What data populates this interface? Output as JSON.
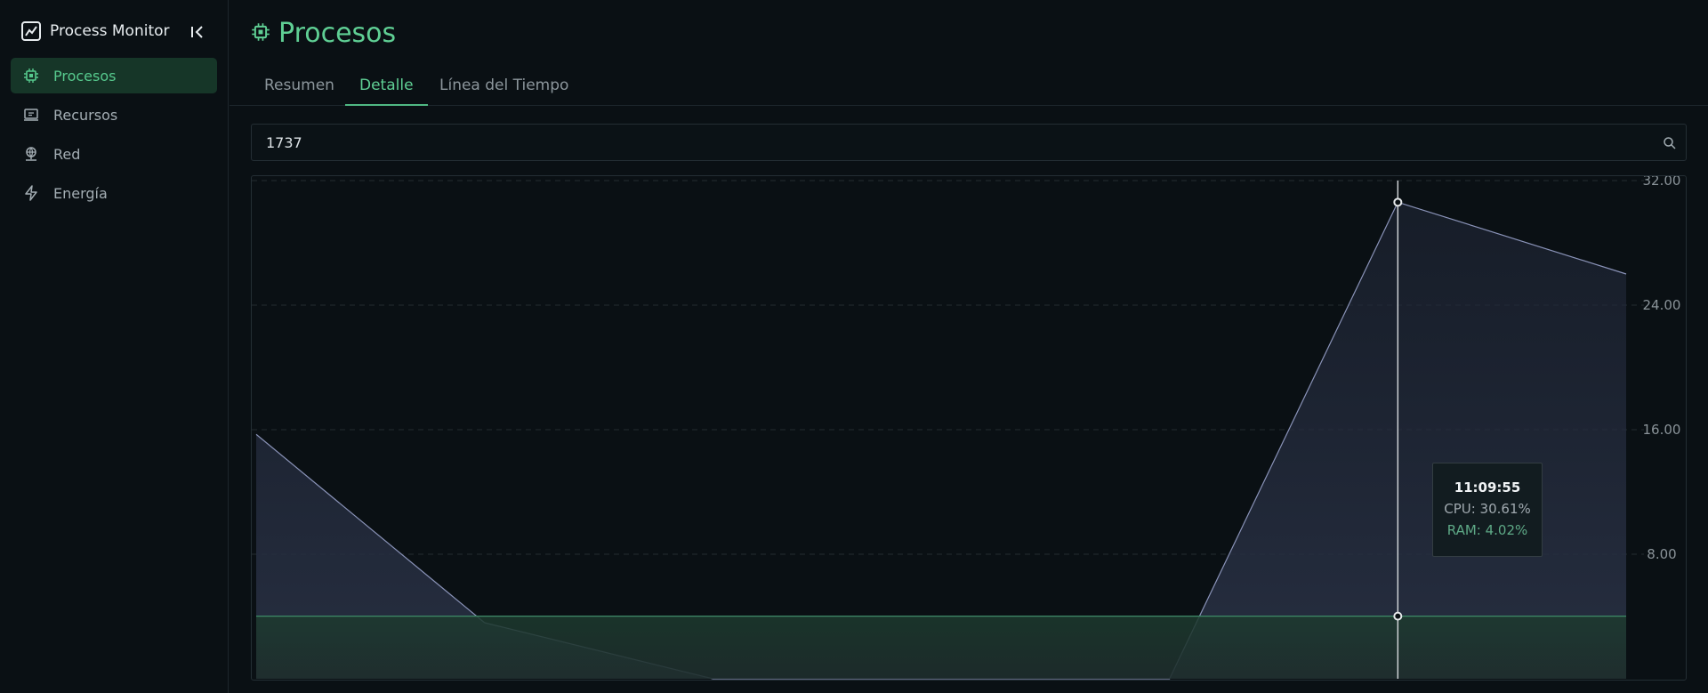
{
  "app": {
    "title": "Process Monitor"
  },
  "sidebar": {
    "items": [
      {
        "label": "Procesos",
        "icon": "cpu-icon",
        "active": true
      },
      {
        "label": "Recursos",
        "icon": "monitor-icon",
        "active": false
      },
      {
        "label": "Red",
        "icon": "network-icon",
        "active": false
      },
      {
        "label": "Energía",
        "icon": "bolt-icon",
        "active": false
      }
    ]
  },
  "header": {
    "title": "Procesos",
    "icon": "cpu-icon"
  },
  "tabs": [
    {
      "label": "Resumen",
      "active": false
    },
    {
      "label": "Detalle",
      "active": true
    },
    {
      "label": "Línea del Tiempo",
      "active": false
    }
  ],
  "search": {
    "value": "1737",
    "placeholder": ""
  },
  "tooltip": {
    "time": "11:09:55",
    "cpu": "CPU: 30.61%",
    "ram": "RAM: 4.02%"
  },
  "colors": {
    "accent": "#5fcf94",
    "cpu_line": "#8a93b8",
    "ram_line": "#3f8a68",
    "background": "#0a1014"
  },
  "chart_data": {
    "type": "area",
    "title": "",
    "xlabel": "",
    "ylabel": "",
    "ylim": [
      0,
      32
    ],
    "yticks": [
      "8.00",
      "16.00",
      "24.00",
      "32.00"
    ],
    "grid": true,
    "series": [
      {
        "name": "CPU",
        "values": [
          15.7,
          3.6,
          0.0,
          0.0,
          0.0,
          30.61,
          26.0
        ]
      },
      {
        "name": "RAM",
        "values": [
          4.02,
          4.02,
          4.02,
          4.02,
          4.02,
          4.02,
          4.02
        ]
      }
    ],
    "highlight_index": 5
  }
}
